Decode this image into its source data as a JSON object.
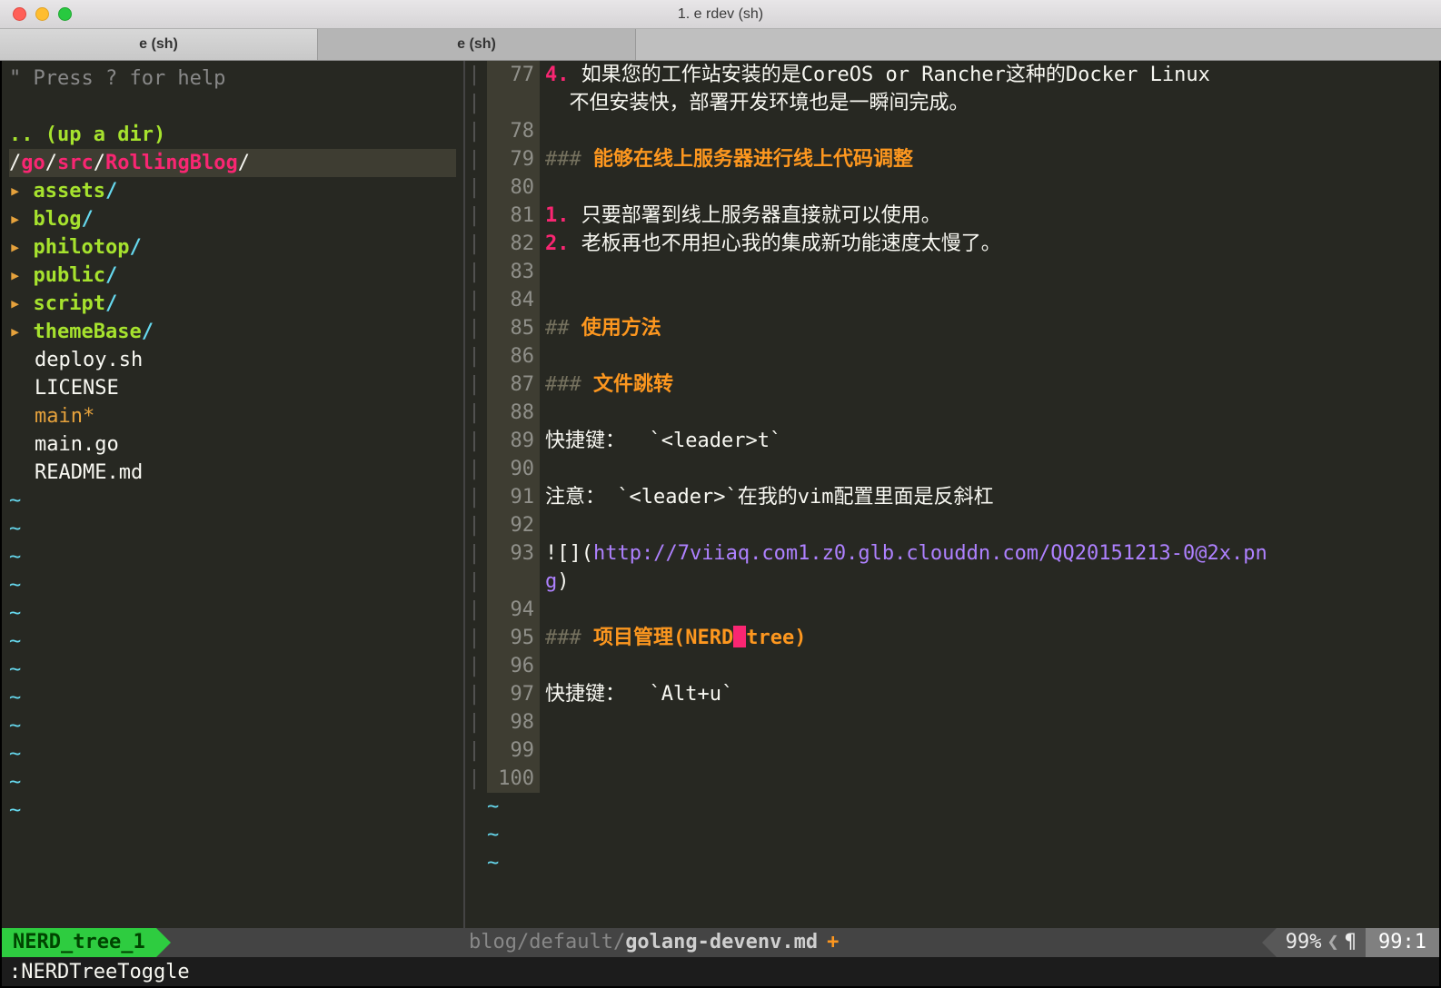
{
  "window": {
    "title": "1. e rdev (sh)"
  },
  "tabs": [
    {
      "label": "e (sh)",
      "active": true
    },
    {
      "label": "e (sh)",
      "active": false
    }
  ],
  "nerdtree": {
    "help": "\" Press ? for help",
    "updir": ".. (up a dir)",
    "path": "/go/src/RollingBlog/",
    "dirs": [
      "assets/",
      "blog/",
      "philotop/",
      "public/",
      "script/",
      "themeBase/"
    ],
    "files": [
      "deploy.sh",
      "LICENSE"
    ],
    "modified": "main*",
    "files2": [
      "main.go",
      "README.md"
    ]
  },
  "code": {
    "lines": [
      {
        "n": 77,
        "type": "list",
        "num": "4.",
        "text": " 如果您的工作站安装的是CoreOS or Rancher这种的Docker Linux",
        "wrap": "不但安装快，部署开发环境也是一瞬间完成。"
      },
      {
        "n": 78,
        "type": "blank"
      },
      {
        "n": 79,
        "type": "h3",
        "text": "能够在线上服务器进行线上代码调整"
      },
      {
        "n": 80,
        "type": "blank"
      },
      {
        "n": 81,
        "type": "list",
        "num": "1.",
        "text": " 只要部署到线上服务器直接就可以使用。"
      },
      {
        "n": 82,
        "type": "list",
        "num": "2.",
        "text": " 老板再也不用担心我的集成新功能速度太慢了。"
      },
      {
        "n": 83,
        "type": "blank"
      },
      {
        "n": 84,
        "type": "blank"
      },
      {
        "n": 85,
        "type": "h2",
        "text": "使用方法"
      },
      {
        "n": 86,
        "type": "blank"
      },
      {
        "n": 87,
        "type": "h3",
        "text": "文件跳转"
      },
      {
        "n": 88,
        "type": "blank"
      },
      {
        "n": 89,
        "type": "plain",
        "pre": "快捷键：  ",
        "code": "`<leader>t`"
      },
      {
        "n": 90,
        "type": "blank"
      },
      {
        "n": 91,
        "type": "plain",
        "pre": "注意： ",
        "code": "`<leader>`",
        "post": "在我的vim配置里面是反斜杠"
      },
      {
        "n": 92,
        "type": "blank"
      },
      {
        "n": 93,
        "type": "image",
        "pre": "![](",
        "url": "http://7viiaq.com1.z0.glb.clouddn.com/QQ20151213-0@2x.pn",
        "wrap": "g",
        "post": ")"
      },
      {
        "n": 94,
        "type": "blank"
      },
      {
        "n": 95,
        "type": "h3cursor",
        "text1": "项目管理(NERD",
        "text2": "tree)"
      },
      {
        "n": 96,
        "type": "blank"
      },
      {
        "n": 97,
        "type": "plain",
        "pre": "快捷键：  ",
        "code": "`Alt+u`"
      },
      {
        "n": 98,
        "type": "blank"
      },
      {
        "n": 99,
        "type": "blank"
      },
      {
        "n": 100,
        "type": "blank"
      }
    ]
  },
  "status": {
    "nerd_label": "NERD_tree_1",
    "file_path_prefix": "blog/default/",
    "file_name": "golang-devenv.md",
    "modified": "+",
    "percent": "99%",
    "line": "99",
    "col": "1"
  },
  "commandline": ":NERDTreeToggle"
}
